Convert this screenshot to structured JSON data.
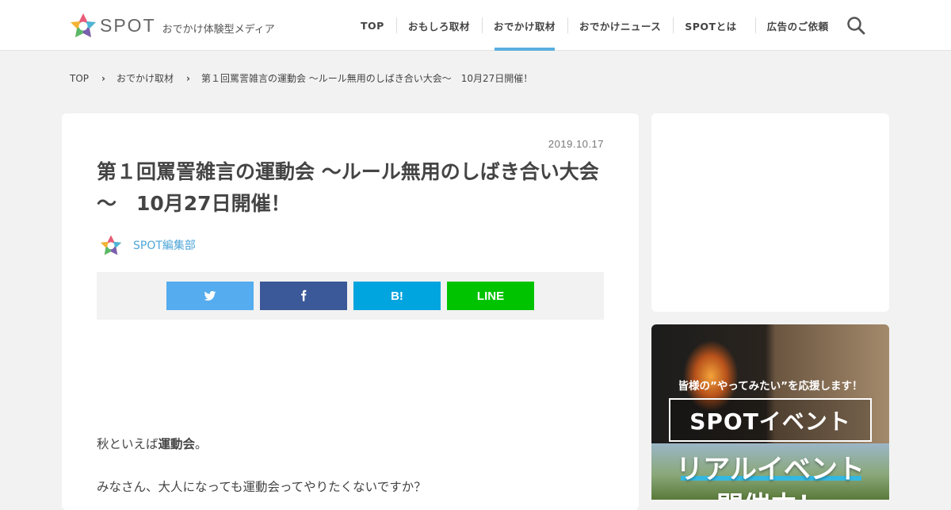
{
  "brand": {
    "name": "SPOT",
    "tagline": "おでかけ体験型メディア"
  },
  "nav": {
    "items": [
      {
        "label": "TOP"
      },
      {
        "label": "おもしろ取材"
      },
      {
        "label": "おでかけ取材"
      },
      {
        "label": "おでかけニュース"
      },
      {
        "label": "SPOTとは"
      },
      {
        "label": "広告のご依頼"
      }
    ],
    "active_item": "おでかけ取材",
    "search_icon": "search-icon"
  },
  "breadcrumb": {
    "items": [
      "TOP",
      "おでかけ取材",
      "第１回罵詈雑言の運動会 ～ルール無用のしばき合い大会～　10月27日開催！"
    ],
    "separator_icon": "chevron-right-icon"
  },
  "article": {
    "date": "2019.10.17",
    "title": "第１回罵詈雑言の運動会 ～ルール無用のしばき合い大会～　10月27日開催！",
    "author": "SPOT編集部",
    "share": {
      "twitter_icon": "twitter-icon",
      "facebook_icon": "facebook-icon",
      "hatena_label": "B!",
      "line_label": "LINE"
    },
    "paragraph_1_prefix": "秋といえば",
    "paragraph_1_bold": "運動会",
    "paragraph_1_suffix": "。",
    "paragraph_2": "みなさん、大人になっても運動会ってやりたくないですか？"
  },
  "sidebar": {
    "banner": {
      "tagline": "皆様の”やってみたい”を応援します！",
      "box_text": "SPOTイベント",
      "headline_1": "リアルイベント",
      "headline_2": "開催中！"
    }
  },
  "colors": {
    "accent": "#5aaee0",
    "twitter": "#55acee",
    "facebook": "#3b5998",
    "hatena": "#00a4de",
    "line": "#00c300"
  }
}
